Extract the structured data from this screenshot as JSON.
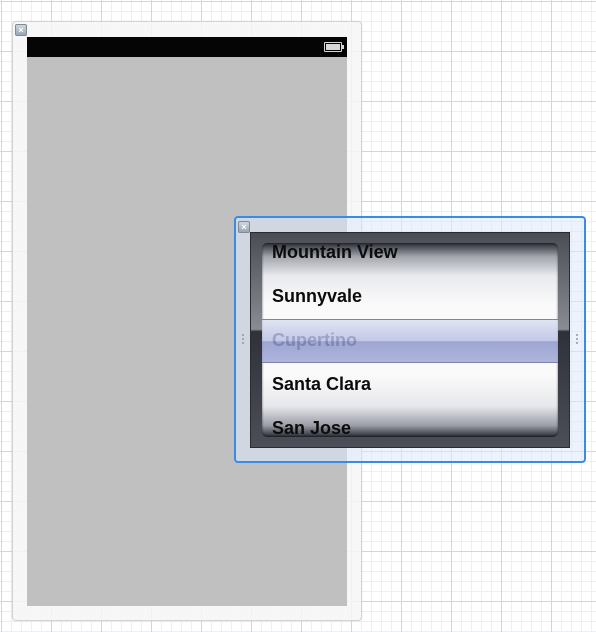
{
  "view_controller": {
    "close_badge_glyph": "×"
  },
  "picker_view": {
    "close_badge_glyph": "×",
    "rows": [
      "Mountain View",
      "Sunnyvale",
      "Cupertino",
      "Santa Clara",
      "San Jose"
    ],
    "selected_row": "Cupertino",
    "colors": {
      "selection_border": "#3a8be6",
      "view_background": "#c0c0c0",
      "status_bar": "#050505"
    }
  }
}
